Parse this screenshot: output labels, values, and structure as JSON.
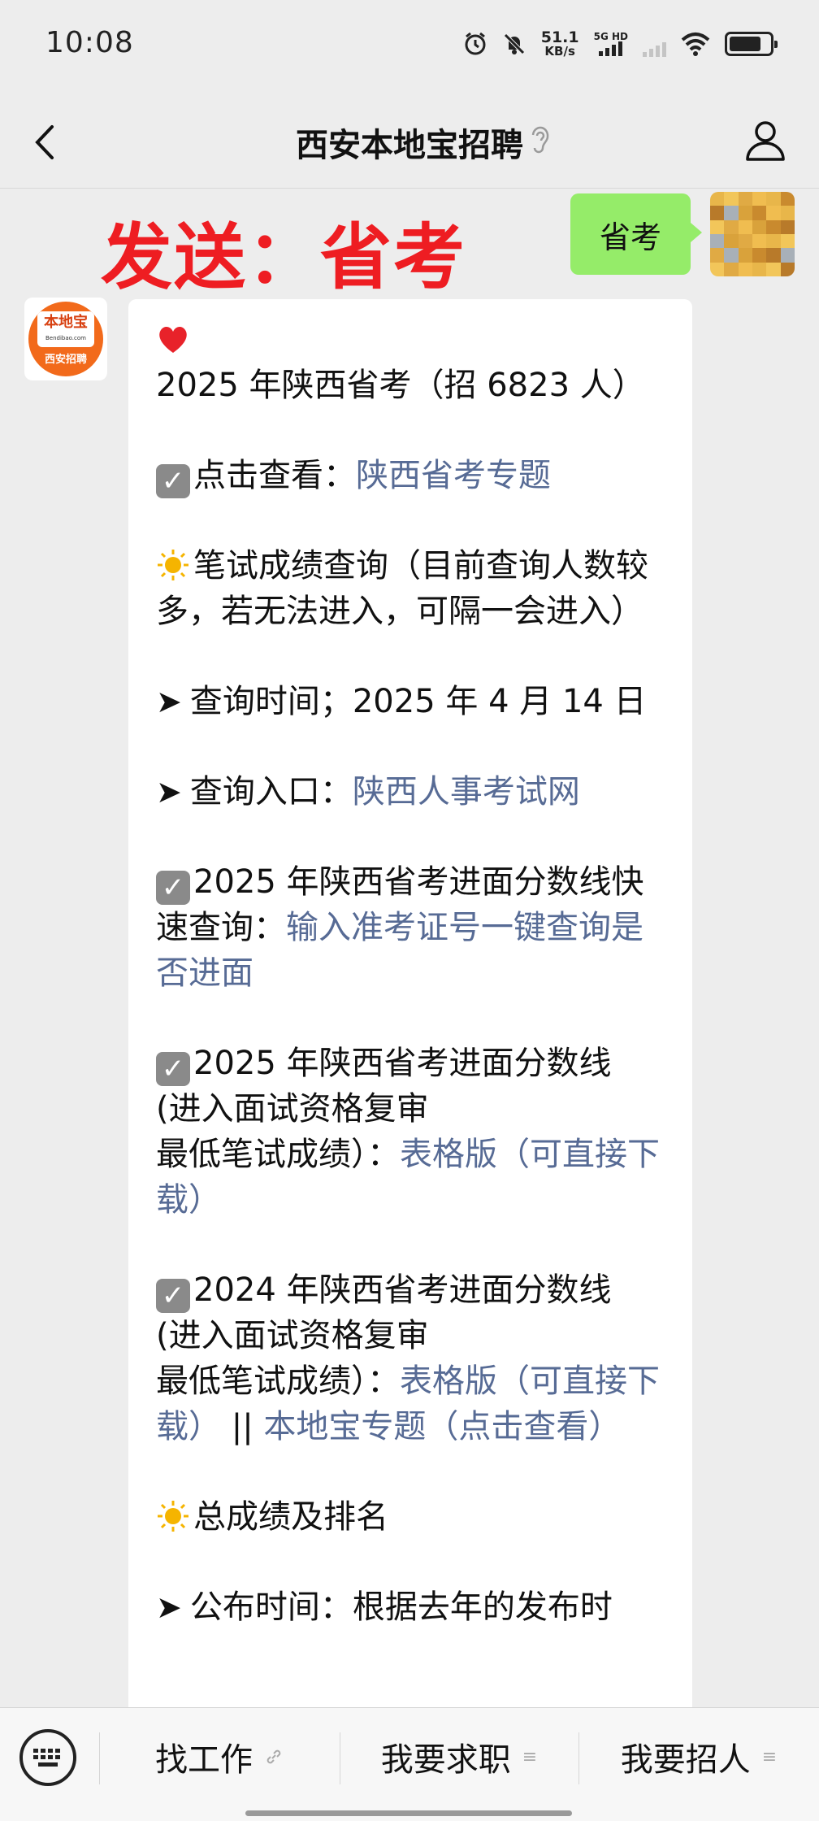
{
  "status_bar": {
    "time": "10:08",
    "net_speed_value": "51.1",
    "net_speed_unit": "KB/s",
    "network_type": "5G HD",
    "battery_level": 0.8
  },
  "nav": {
    "title": "西安本地宝招聘"
  },
  "promo_text": "发送：省考",
  "sent_message": "省考",
  "bot_avatar": {
    "logo_text": "本地宝",
    "logo_domain": "Bendibao.com",
    "logo_caption": "西安招聘"
  },
  "message": {
    "p1": "2025 年陕西省考（招 6823 人）",
    "p2_text": "点击查看：",
    "p2_link": "陕西省考专题",
    "p3": "笔试成绩查询（目前查询人数较多，若无法进入，可隔一会进入）",
    "p4": "查询时间；2025 年 4 月 14 日",
    "p5_text": "查询入口：",
    "p5_link": "陕西人事考试网",
    "p6_text": "2025 年陕西省考进面分数线快速查询：",
    "p6_link": "输入准考证号一键查询是否进面",
    "p7_line1": "2025 年陕西省考进面分数线",
    "p7_line2": "(进入面试资格复审",
    "p7_line3_text": "最低笔试成绩）：",
    "p7_link": "表格版（可直接下载）",
    "p8_line1": "2024 年陕西省考进面分数线",
    "p8_line2": "(进入面试资格复审",
    "p8_line3_text": "最低笔试成绩）：",
    "p8_link1": "表格版（可直接下载）",
    "p8_sep": " || ",
    "p8_link2": "本地宝专题（点击查看）",
    "p9": "总成绩及排名",
    "p10": "公布时间：根据去年的发布时"
  },
  "bottom_menu": {
    "item1": "找工作",
    "item2": "我要求职",
    "item3": "我要招人"
  },
  "colors": {
    "link": "#576b95",
    "promo": "#ee1d22",
    "sent_bubble": "#95ec69"
  }
}
